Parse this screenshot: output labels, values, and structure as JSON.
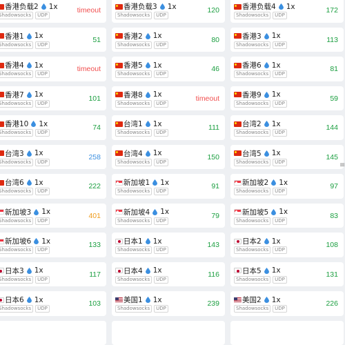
{
  "tags": {
    "protocol": "Shadowsocks",
    "transport": "UDP"
  },
  "multiplier_default": "1x",
  "edge_glyph": "≡",
  "colors": {
    "good": "#1a9e3f",
    "mid": "#3b8fe0",
    "warn": "#ef9a1a",
    "bad": "#f14e4e"
  },
  "nodes": [
    {
      "name": "香港负载2",
      "flag": "cn",
      "multiplier": "1x",
      "delay": "timeout",
      "status": "bad"
    },
    {
      "name": "香港负载3",
      "flag": "cn",
      "multiplier": "1x",
      "delay": "120",
      "status": "good"
    },
    {
      "name": "香港负载4",
      "flag": "cn",
      "multiplier": "1x",
      "delay": "172",
      "status": "good"
    },
    {
      "name": "香港1",
      "flag": "cn",
      "multiplier": "1x",
      "delay": "51",
      "status": "good"
    },
    {
      "name": "香港2",
      "flag": "cn",
      "multiplier": "1x",
      "delay": "80",
      "status": "good"
    },
    {
      "name": "香港3",
      "flag": "cn",
      "multiplier": "1x",
      "delay": "113",
      "status": "good"
    },
    {
      "name": "香港4",
      "flag": "cn",
      "multiplier": "1x",
      "delay": "timeout",
      "status": "bad"
    },
    {
      "name": "香港5",
      "flag": "cn",
      "multiplier": "1x",
      "delay": "46",
      "status": "good"
    },
    {
      "name": "香港6",
      "flag": "cn",
      "multiplier": "1x",
      "delay": "81",
      "status": "good"
    },
    {
      "name": "香港7",
      "flag": "cn",
      "multiplier": "1x",
      "delay": "101",
      "status": "good"
    },
    {
      "name": "香港8",
      "flag": "cn",
      "multiplier": "1x",
      "delay": "timeout",
      "status": "bad"
    },
    {
      "name": "香港9",
      "flag": "cn",
      "multiplier": "1x",
      "delay": "59",
      "status": "good"
    },
    {
      "name": "香港10",
      "flag": "cn",
      "multiplier": "1x",
      "delay": "74",
      "status": "good"
    },
    {
      "name": "台湾1",
      "flag": "cn",
      "multiplier": "1x",
      "delay": "111",
      "status": "good"
    },
    {
      "name": "台湾2",
      "flag": "cn",
      "multiplier": "1x",
      "delay": "144",
      "status": "good"
    },
    {
      "name": "台湾3",
      "flag": "cn",
      "multiplier": "1x",
      "delay": "258",
      "status": "mid"
    },
    {
      "name": "台湾4",
      "flag": "cn",
      "multiplier": "1x",
      "delay": "150",
      "status": "good"
    },
    {
      "name": "台湾5",
      "flag": "cn",
      "multiplier": "1x",
      "delay": "145",
      "status": "good"
    },
    {
      "name": "台湾6",
      "flag": "cn",
      "multiplier": "1x",
      "delay": "222",
      "status": "good"
    },
    {
      "name": "新加坡1",
      "flag": "sg",
      "multiplier": "1x",
      "delay": "91",
      "status": "good"
    },
    {
      "name": "新加坡2",
      "flag": "sg",
      "multiplier": "1x",
      "delay": "97",
      "status": "good"
    },
    {
      "name": "新加坡3",
      "flag": "sg",
      "multiplier": "1x",
      "delay": "401",
      "status": "warn"
    },
    {
      "name": "新加坡4",
      "flag": "sg",
      "multiplier": "1x",
      "delay": "79",
      "status": "good"
    },
    {
      "name": "新加坡5",
      "flag": "sg",
      "multiplier": "1x",
      "delay": "83",
      "status": "good"
    },
    {
      "name": "新加坡6",
      "flag": "sg",
      "multiplier": "1x",
      "delay": "133",
      "status": "good"
    },
    {
      "name": "日本1",
      "flag": "jp",
      "multiplier": "1x",
      "delay": "143",
      "status": "good"
    },
    {
      "name": "日本2",
      "flag": "jp",
      "multiplier": "1x",
      "delay": "108",
      "status": "good"
    },
    {
      "name": "日本3",
      "flag": "jp",
      "multiplier": "1x",
      "delay": "117",
      "status": "good"
    },
    {
      "name": "日本4",
      "flag": "jp",
      "multiplier": "1x",
      "delay": "116",
      "status": "good"
    },
    {
      "name": "日本5",
      "flag": "jp",
      "multiplier": "1x",
      "delay": "131",
      "status": "good"
    },
    {
      "name": "日本6",
      "flag": "jp",
      "multiplier": "1x",
      "delay": "103",
      "status": "good"
    },
    {
      "name": "美国1",
      "flag": "us",
      "multiplier": "1x",
      "delay": "239",
      "status": "good"
    },
    {
      "name": "美国2",
      "flag": "us",
      "multiplier": "1x",
      "delay": "226",
      "status": "good"
    },
    {
      "name": "",
      "flag": "",
      "multiplier": "",
      "delay": "",
      "status": ""
    },
    {
      "name": "",
      "flag": "",
      "multiplier": "",
      "delay": "",
      "status": ""
    },
    {
      "name": "",
      "flag": "",
      "multiplier": "",
      "delay": "",
      "status": ""
    }
  ]
}
